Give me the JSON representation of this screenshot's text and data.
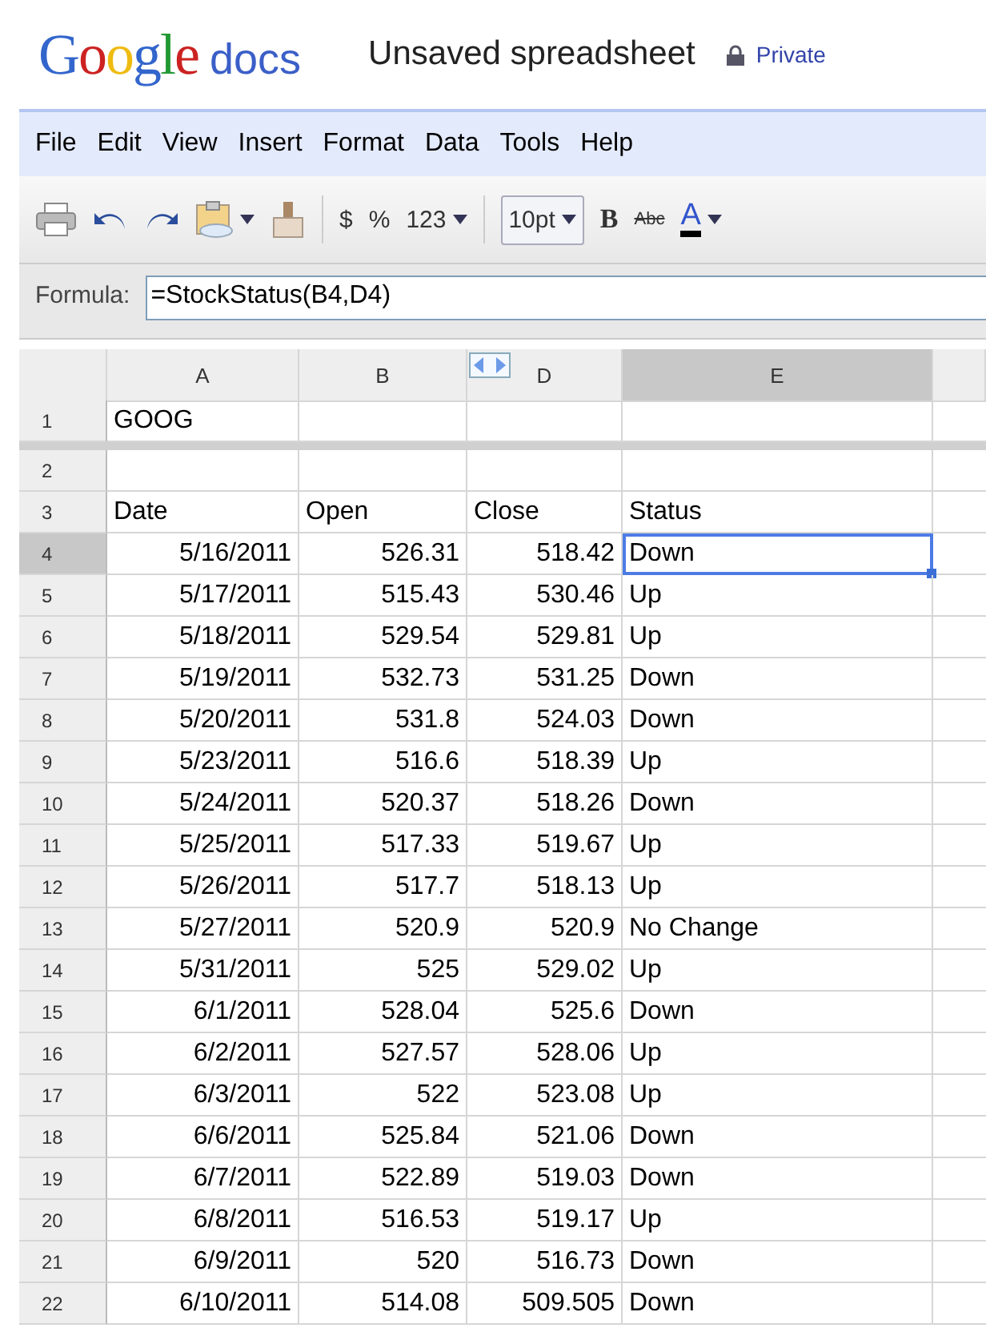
{
  "header": {
    "logo_brand": "Google",
    "logo_product": "docs",
    "title": "Unsaved spreadsheet",
    "privacy": "Private"
  },
  "menu": [
    "File",
    "Edit",
    "View",
    "Insert",
    "Format",
    "Data",
    "Tools",
    "Help"
  ],
  "toolbar": {
    "currency": "$",
    "percent": "%",
    "number_format": "123",
    "font_size": "10pt",
    "bold": "B",
    "strikethrough": "Abc",
    "text_color": "A"
  },
  "formula": {
    "label": "Formula:",
    "value": "=StockStatus(B4,D4)"
  },
  "columns": [
    {
      "label": "A",
      "selected": false
    },
    {
      "label": "B",
      "selected": false
    },
    {
      "label": "D",
      "selected": false
    },
    {
      "label": "E",
      "selected": true
    }
  ],
  "rows": [
    {
      "number": "1",
      "cells": [
        "GOOG",
        "",
        "",
        ""
      ],
      "selected": false
    },
    {
      "number": "2",
      "cells": [
        "",
        "",
        "",
        ""
      ],
      "selected": false
    },
    {
      "number": "3",
      "cells": [
        "Date",
        "Open",
        "Close",
        "Status"
      ],
      "selected": false
    },
    {
      "number": "4",
      "cells": [
        "5/16/2011",
        "526.31",
        "518.42",
        "Down"
      ],
      "selected": true
    },
    {
      "number": "5",
      "cells": [
        "5/17/2011",
        "515.43",
        "530.46",
        "Up"
      ],
      "selected": false
    },
    {
      "number": "6",
      "cells": [
        "5/18/2011",
        "529.54",
        "529.81",
        "Up"
      ],
      "selected": false
    },
    {
      "number": "7",
      "cells": [
        "5/19/2011",
        "532.73",
        "531.25",
        "Down"
      ],
      "selected": false
    },
    {
      "number": "8",
      "cells": [
        "5/20/2011",
        "531.8",
        "524.03",
        "Down"
      ],
      "selected": false
    },
    {
      "number": "9",
      "cells": [
        "5/23/2011",
        "516.6",
        "518.39",
        "Up"
      ],
      "selected": false
    },
    {
      "number": "10",
      "cells": [
        "5/24/2011",
        "520.37",
        "518.26",
        "Down"
      ],
      "selected": false
    },
    {
      "number": "11",
      "cells": [
        "5/25/2011",
        "517.33",
        "519.67",
        "Up"
      ],
      "selected": false
    },
    {
      "number": "12",
      "cells": [
        "5/26/2011",
        "517.7",
        "518.13",
        "Up"
      ],
      "selected": false
    },
    {
      "number": "13",
      "cells": [
        "5/27/2011",
        "520.9",
        "520.9",
        "No Change"
      ],
      "selected": false
    },
    {
      "number": "14",
      "cells": [
        "5/31/2011",
        "525",
        "529.02",
        "Up"
      ],
      "selected": false
    },
    {
      "number": "15",
      "cells": [
        "6/1/2011",
        "528.04",
        "525.6",
        "Down"
      ],
      "selected": false
    },
    {
      "number": "16",
      "cells": [
        "6/2/2011",
        "527.57",
        "528.06",
        "Up"
      ],
      "selected": false
    },
    {
      "number": "17",
      "cells": [
        "6/3/2011",
        "522",
        "523.08",
        "Up"
      ],
      "selected": false
    },
    {
      "number": "18",
      "cells": [
        "6/6/2011",
        "525.84",
        "521.06",
        "Down"
      ],
      "selected": false
    },
    {
      "number": "19",
      "cells": [
        "6/7/2011",
        "522.89",
        "519.03",
        "Down"
      ],
      "selected": false
    },
    {
      "number": "20",
      "cells": [
        "6/8/2011",
        "516.53",
        "519.17",
        "Up"
      ],
      "selected": false
    },
    {
      "number": "21",
      "cells": [
        "6/9/2011",
        "520",
        "516.73",
        "Down"
      ],
      "selected": false
    },
    {
      "number": "22",
      "cells": [
        "6/10/2011",
        "514.08",
        "509.505",
        "Down"
      ],
      "selected": false
    }
  ]
}
